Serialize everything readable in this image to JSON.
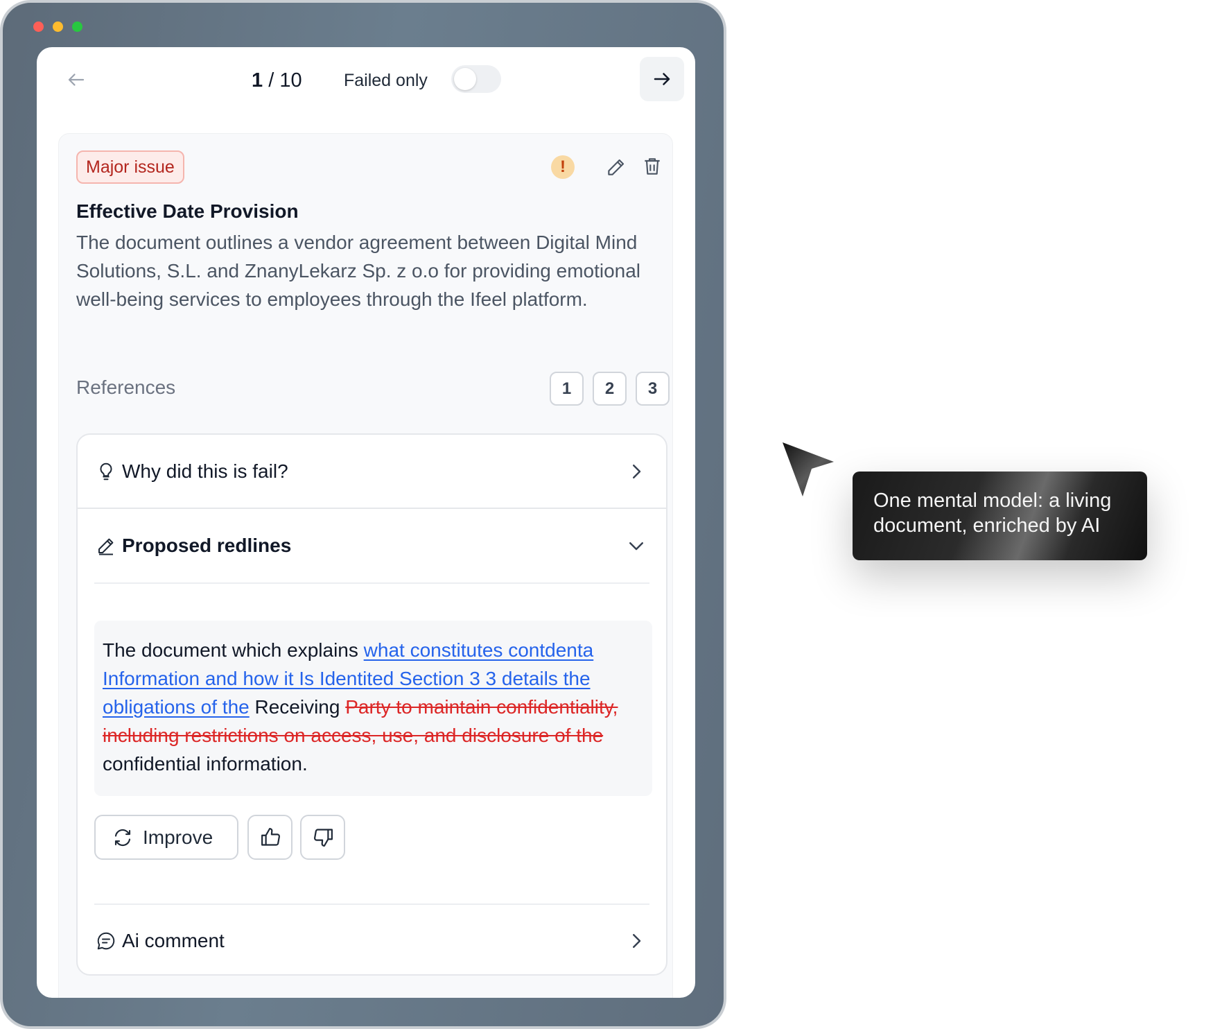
{
  "window": {
    "controls": [
      "close",
      "minimize",
      "maximize"
    ]
  },
  "nav": {
    "current": "1",
    "total": "10",
    "separator": " / ",
    "filter_label": "Failed only",
    "filter_on": false,
    "back_icon": "arrow-left-icon",
    "next_icon": "arrow-right-icon"
  },
  "issue": {
    "severity": "Major issue",
    "title": "Effective Date Provision",
    "description": "The document outlines a vendor agreement between Digital Mind Solutions, S.L. and ZnanyLekarz Sp. z o.o for providing emotional well-being services to employees through the Ifeel platform.",
    "references_label": "References",
    "references": [
      "1",
      "2",
      "3"
    ],
    "icons": {
      "warning": "!",
      "edit": "pencil-icon",
      "delete": "trash-icon"
    }
  },
  "sections": {
    "why": {
      "label": "Why did this is fail?",
      "icon": "lightbulb-icon"
    },
    "redlines": {
      "label": "Proposed redlines",
      "icon": "pencil-icon",
      "text_plain_1": "The document which explains ",
      "text_inserted": "what constitutes contdenta Information and how it Is Identited Section 3 3 details the obligations of the",
      "text_plain_2": " Receiving ",
      "text_deleted": "Party to maintain confidentiality, including restrictions on access, use, and disclosure of the ",
      "text_plain_3": "confidential information."
    },
    "actions": {
      "improve_label": "Improve",
      "improve_icon": "refresh-icon",
      "like_icon": "thumbs-up-icon",
      "dislike_icon": "thumbs-down-icon"
    },
    "ai_comment": {
      "label": "Ai comment",
      "icon": "chat-bubble-icon"
    }
  },
  "tooltip": {
    "text": "One mental model: a living document, enriched by AI"
  },
  "colors": {
    "accent_link": "#2563eb",
    "deleted": "#dc2626",
    "badge_text": "#b3261e",
    "badge_bg": "#fdecea",
    "window_frame": "#667685"
  }
}
